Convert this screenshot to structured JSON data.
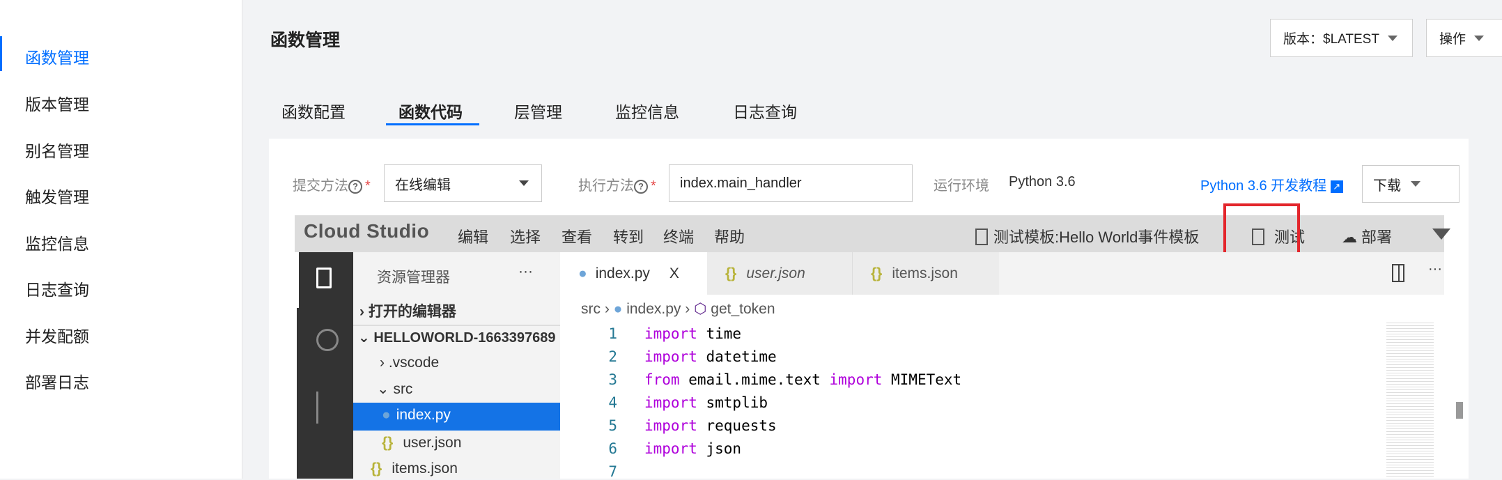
{
  "sidebar": {
    "items": [
      {
        "label": "函数管理",
        "active": true
      },
      {
        "label": "版本管理"
      },
      {
        "label": "别名管理"
      },
      {
        "label": "触发管理"
      },
      {
        "label": "监控信息"
      },
      {
        "label": "日志查询"
      },
      {
        "label": "并发配额"
      },
      {
        "label": "部署日志"
      }
    ]
  },
  "header": {
    "title": "函数管理",
    "version_label": "版本：$LATEST",
    "ops_label": "操作"
  },
  "tabs": [
    {
      "label": "函数配置"
    },
    {
      "label": "函数代码",
      "active": true
    },
    {
      "label": "层管理"
    },
    {
      "label": "监控信息"
    },
    {
      "label": "日志查询"
    }
  ],
  "form": {
    "submit_label": "提交方法",
    "submit_value": "在线编辑",
    "exec_label": "执行方法",
    "exec_value": "index.main_handler",
    "runtime_label": "运行环境",
    "runtime_value": "Python 3.6",
    "tutorial_link": "Python 3.6 开发教程",
    "download_label": "下载"
  },
  "studio": {
    "logo": "Cloud Studio",
    "menu": [
      "编辑",
      "选择",
      "查看",
      "转到",
      "终端",
      "帮助"
    ],
    "template_label": "测试模板:Hello World事件模板",
    "test_label": "测试",
    "deploy_label": "部署"
  },
  "explorer": {
    "title": "资源管理器",
    "more": "···",
    "open_editors": "打开的编辑器",
    "project": "HELLOWORLD-1663397689",
    "items": [
      ".vscode",
      "src",
      "index.py",
      "user.json",
      "items.json"
    ]
  },
  "editor": {
    "tabs": [
      "index.py",
      "user.json",
      "items.json"
    ],
    "close": "X",
    "more": "···",
    "breadcrumb": [
      "src",
      "index.py",
      "get_token"
    ],
    "lines": [
      {
        "n": "1",
        "kw": "import",
        "rest": " time"
      },
      {
        "n": "2",
        "kw": "import",
        "rest": " datetime"
      },
      {
        "n": "3",
        "kw": "from",
        "rest": " email.mime.text ",
        "kw2": "import",
        "rest2": " MIMEText"
      },
      {
        "n": "4",
        "kw": "import",
        "rest": " smtplib"
      },
      {
        "n": "5",
        "kw": "import",
        "rest": " requests"
      },
      {
        "n": "6",
        "kw": "import",
        "rest": " json"
      },
      {
        "n": "7",
        "kw": "",
        "rest": ""
      }
    ]
  },
  "colors": {
    "accent": "#006eff",
    "highlight_box": "#e3262c",
    "selection": "#1473e6",
    "keyword": "#af00db"
  }
}
